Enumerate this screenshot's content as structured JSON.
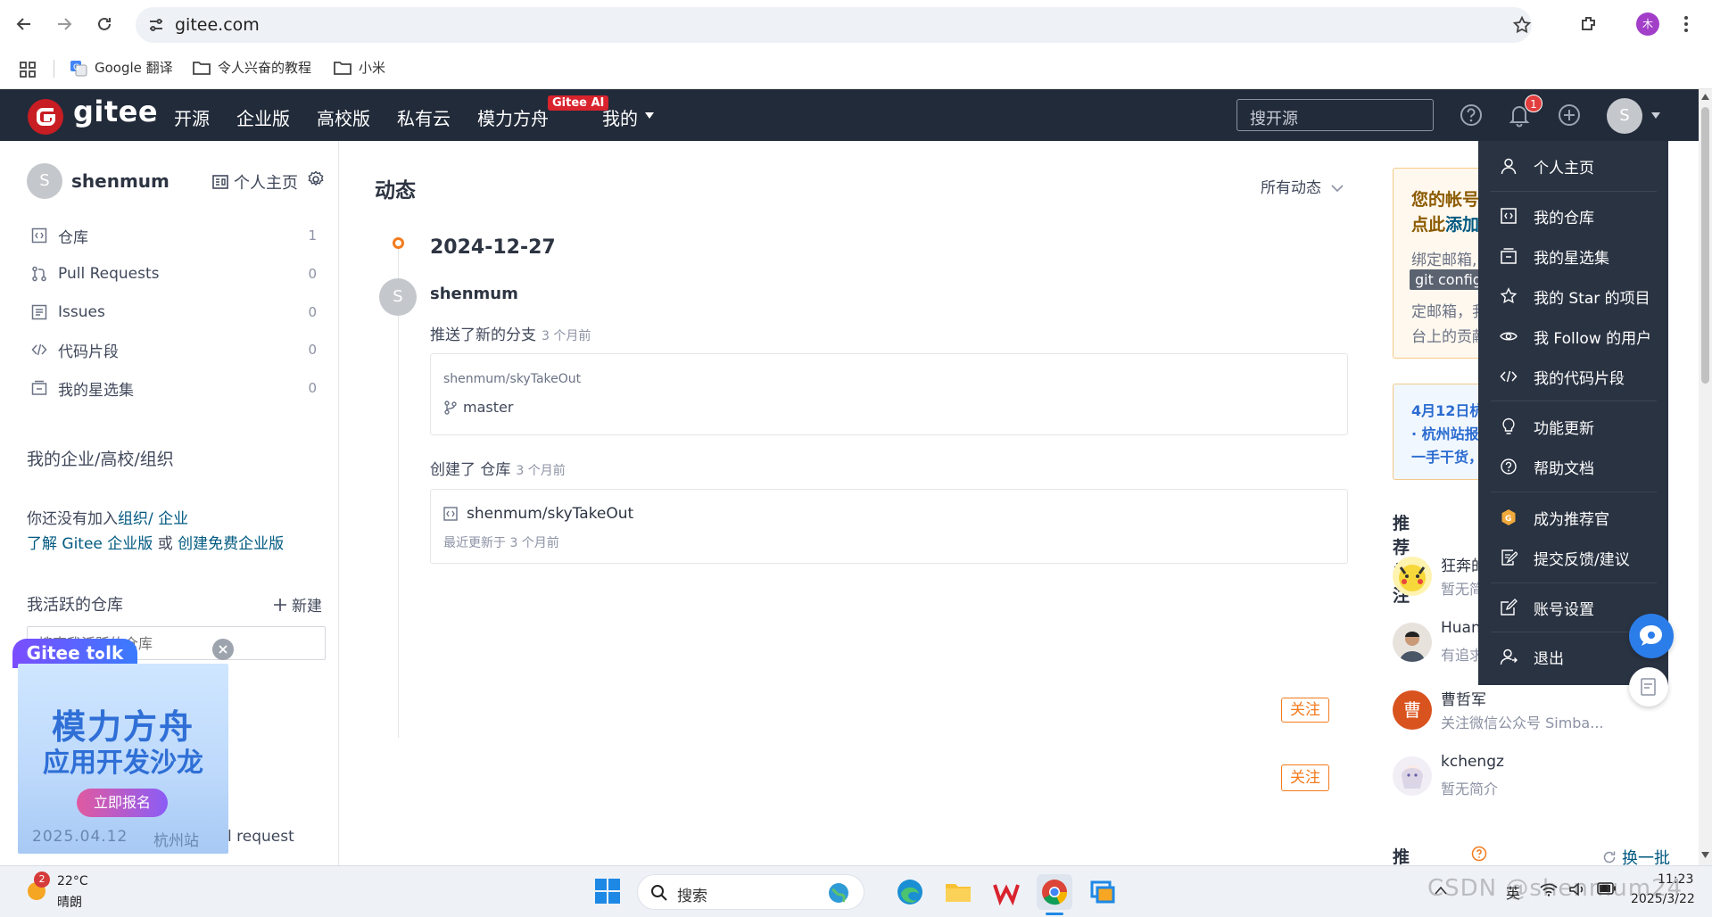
{
  "browser": {
    "url": "gitee.com",
    "bookmarks": [
      {
        "label": "Google 翻译",
        "icon": "translate-icon"
      },
      {
        "label": "令人兴奋的教程",
        "icon": "folder-icon"
      },
      {
        "label": "小米",
        "icon": "folder-icon"
      }
    ],
    "profile_initial": "木"
  },
  "header": {
    "brand": "gitee",
    "nav": [
      "开源",
      "企业版",
      "高校版",
      "私有云",
      "模力方舟",
      "我的"
    ],
    "ai_badge": "Gitee AI",
    "search_placeholder": "搜开源",
    "notification_count": "1",
    "avatar_initial": "S"
  },
  "sidebar": {
    "avatar_initial": "S",
    "username": "shenmum",
    "homepage_label": "个人主页",
    "items": [
      {
        "label": "仓库",
        "count": "1",
        "icon": "repo-icon"
      },
      {
        "label": "Pull Requests",
        "count": "0",
        "icon": "pull-request-icon"
      },
      {
        "label": "Issues",
        "count": "0",
        "icon": "issue-icon"
      },
      {
        "label": "代码片段",
        "count": "0",
        "icon": "code-icon"
      },
      {
        "label": "我的星选集",
        "count": "0",
        "icon": "collection-icon"
      }
    ],
    "org_title": "我的企业/高校/组织",
    "org_text1": "你还没有加入",
    "org_link1": "组织",
    "org_sep": "/ ",
    "org_link2": "企业",
    "org_link3": "了解 Gitee 企业版",
    "org_or": " 或 ",
    "org_link4": "创建免费企业版",
    "active_repos_title": "我活跃的仓库",
    "new_label": "新建",
    "repo_search_placeholder": "搜索我活跃的仓库",
    "bottom_partial": "l request"
  },
  "feed": {
    "title": "动态",
    "filter": "所有动态",
    "date": "2024-12-27",
    "avatar_initial": "S",
    "user": "shenmum",
    "event1_text": "推送了新的分支",
    "event1_time": "3 个月前",
    "event1_repo": "shenmum/skyTakeOut",
    "event1_branch": "master",
    "event2_text": "创建了 仓库",
    "event2_time": "3 个月前",
    "event2_repo": "shenmum/skyTakeOut",
    "event2_updated": "最近更新于 3 个月前"
  },
  "right": {
    "notice_line1": "您的帐号",
    "notice_line2a": "点此",
    "notice_line2b": "添加",
    "notice_line3": "绑定邮箱,",
    "notice_code": "git config",
    "notice_line4": "定邮箱，我",
    "notice_line5": "台上的贡献",
    "event_line1": "4月12日杭",
    "event_line2": "· 杭州站报",
    "event_line3": "一手干货，",
    "rec_title": "推荐关注",
    "rec_users": [
      {
        "name": "狂奔的",
        "desc": "暂无简介",
        "follow": ""
      },
      {
        "name": "Huan",
        "desc": "有追求",
        "follow": ""
      },
      {
        "name": "曹哲军",
        "desc": "关注微信公众号 Simba...",
        "follow": "关注"
      },
      {
        "name": "kchengz",
        "desc": "暂无简介",
        "follow": "关注"
      }
    ],
    "rec_avatar_text": "曹",
    "rec_repos_title": "推荐仓库",
    "refresh_label": "换一批"
  },
  "user_menu": {
    "items": [
      {
        "label": "个人主页",
        "icon": "user-icon"
      },
      {
        "label": "我的仓库",
        "icon": "repo-icon"
      },
      {
        "label": "我的星选集",
        "icon": "collection-icon"
      },
      {
        "label": "我的 Star 的项目",
        "icon": "star-icon"
      },
      {
        "label": "我 Follow 的用户",
        "icon": "eye-icon"
      },
      {
        "label": "我的代码片段",
        "icon": "code-icon"
      },
      {
        "label": "功能更新",
        "icon": "lightbulb-icon"
      },
      {
        "label": "帮助文档",
        "icon": "help-icon"
      },
      {
        "label": "成为推荐官",
        "icon": "recommender-icon"
      },
      {
        "label": "提交反馈/建议",
        "icon": "feedback-icon"
      },
      {
        "label": "账号设置",
        "icon": "settings-icon"
      },
      {
        "label": "退出",
        "icon": "logout-icon"
      }
    ]
  },
  "promo": {
    "tag_a": "Gitee t",
    "tag_b": "lk",
    "line1": "模力方舟",
    "line2": "应用开发沙龙",
    "button": "立即报名",
    "date": "2025.04.12",
    "city": "杭州站"
  },
  "taskbar": {
    "weather_badge": "2",
    "temperature": "22°C",
    "weather": "晴朗",
    "search_label": "搜索",
    "ime": "英",
    "time": "11:23",
    "date": "2025/3/22",
    "watermark": "CSDN @shenmum24"
  },
  "colors": {
    "header_bg": "#222b3a",
    "menu_bg": "#2a3342",
    "brand_red": "#c71d23",
    "accent_orange": "#f37b1d",
    "link_blue": "#005980"
  }
}
